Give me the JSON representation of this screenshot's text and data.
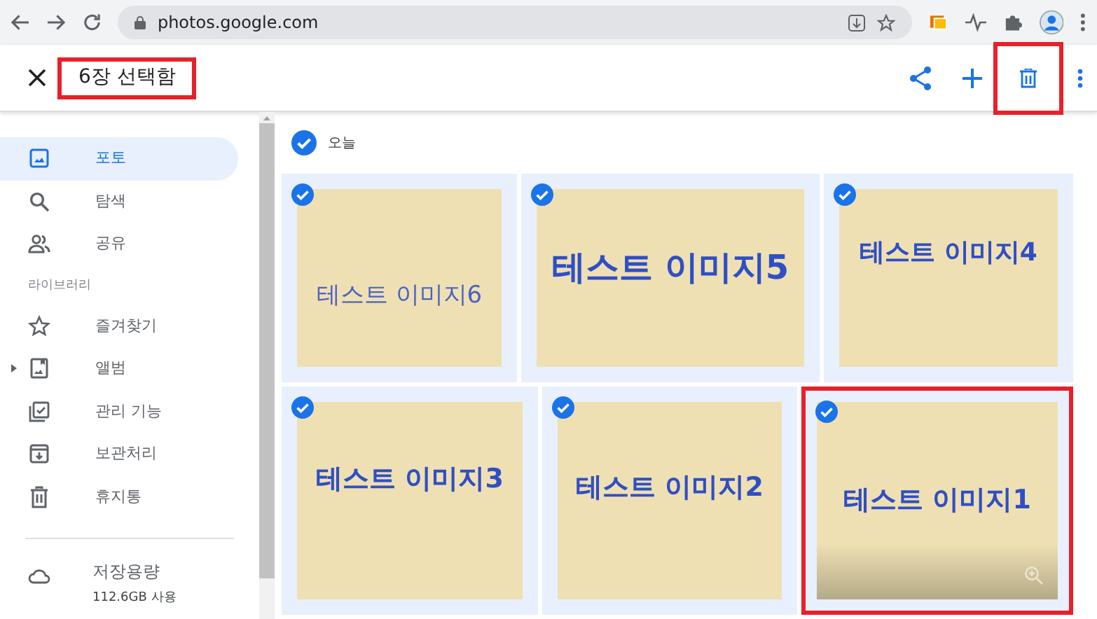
{
  "browser": {
    "url": "photos.google.com"
  },
  "header": {
    "title": "6장 선택함",
    "title_highlighted": true,
    "delete_highlighted": true
  },
  "sidebar": {
    "items": [
      {
        "label": "포토",
        "selected": true,
        "expandable": false
      },
      {
        "label": "탐색",
        "selected": false,
        "expandable": false
      },
      {
        "label": "공유",
        "selected": false,
        "expandable": false
      }
    ],
    "library_heading": "라이브러리",
    "library_items": [
      {
        "label": "즐겨찾기",
        "selected": false,
        "expandable": false
      },
      {
        "label": "앨범",
        "selected": false,
        "expandable": true
      },
      {
        "label": "관리 기능",
        "selected": false,
        "expandable": false
      },
      {
        "label": "보관처리",
        "selected": false,
        "expandable": false
      },
      {
        "label": "휴지통",
        "selected": false,
        "expandable": false
      }
    ],
    "storage": {
      "label": "저장용량",
      "usage": "112.6GB 사용"
    }
  },
  "section": {
    "label": "오늘",
    "selected": true
  },
  "photo_rows": [
    [
      {
        "text": "테스트 이미지6",
        "selected": true,
        "hovered": false,
        "highlighted": false
      },
      {
        "text": "테스트 이미지5",
        "selected": true,
        "hovered": false,
        "highlighted": false
      },
      {
        "text": "테스트 이미지4",
        "selected": true,
        "hovered": false,
        "highlighted": false
      }
    ],
    [
      {
        "text": "테스트 이미지3",
        "selected": true,
        "hovered": false,
        "highlighted": false
      },
      {
        "text": "테스트 이미지2",
        "selected": true,
        "hovered": false,
        "highlighted": false
      },
      {
        "text": "테스트 이미지1",
        "selected": true,
        "hovered": true,
        "highlighted": true
      }
    ]
  ]
}
